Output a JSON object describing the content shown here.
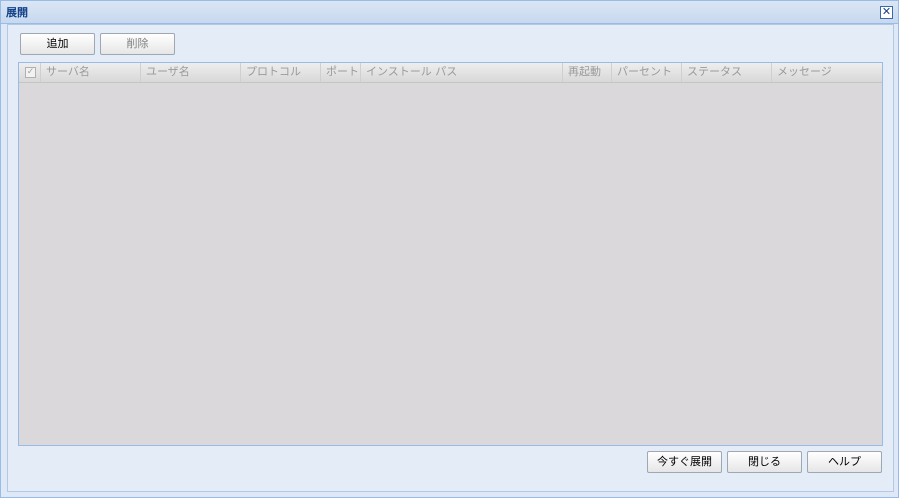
{
  "window": {
    "title": "展開",
    "close_icon_glyph": "✕"
  },
  "toolbar": {
    "add_label": "追加",
    "delete_label": "削除"
  },
  "grid": {
    "checkbox_glyph": "✓",
    "columns": [
      "サーバ名",
      "ユーザ名",
      "プロトコル",
      "ポート",
      "インストール パス",
      "再起動",
      "パーセント",
      "ステータス",
      "メッセージ"
    ],
    "rows": []
  },
  "footer": {
    "deploy_now_label": "今すぐ展開",
    "close_label": "閉じる",
    "help_label": "ヘルプ"
  },
  "colors": {
    "title_text": "#15428b",
    "grid_body": "#dbd8dc",
    "panel_bg": "#e3ecf7",
    "border": "#99bbe8"
  }
}
